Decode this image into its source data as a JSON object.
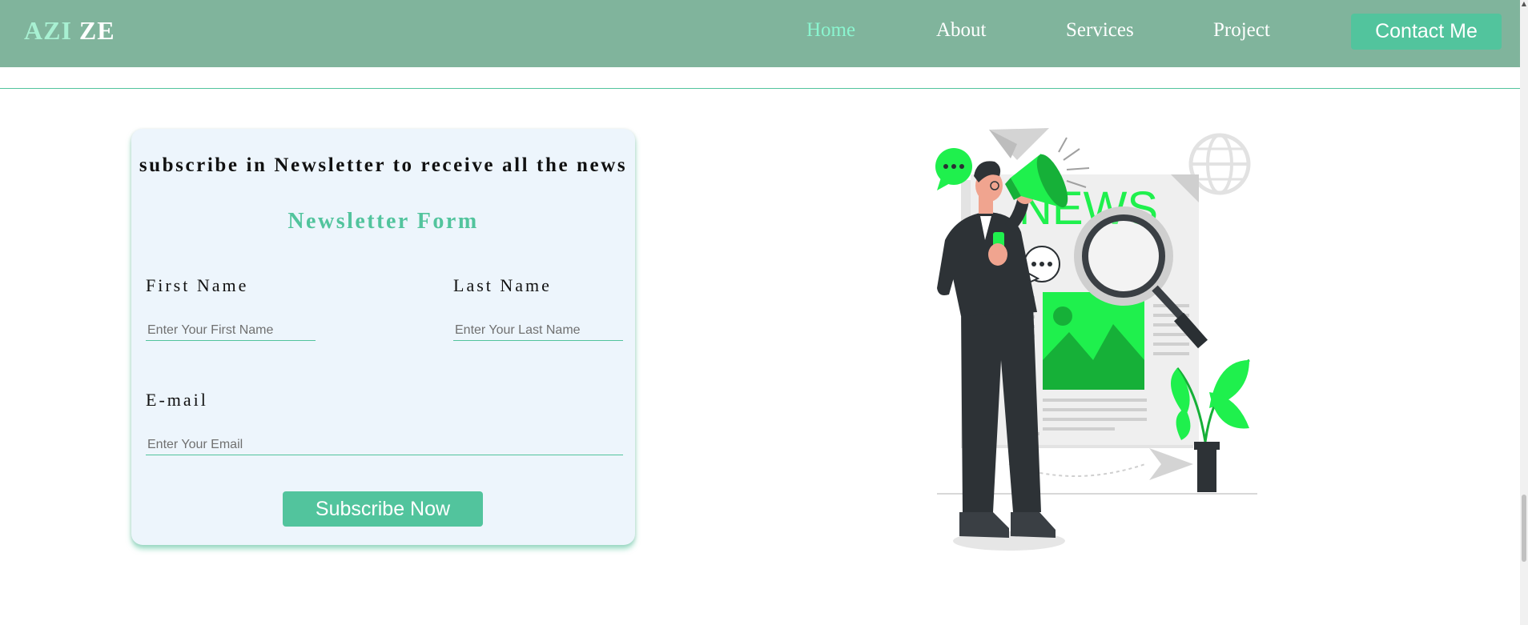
{
  "nav": {
    "logo_part1": "AZI",
    "logo_part2": "ZE",
    "links": [
      "Home",
      "About",
      "Services",
      "Project"
    ],
    "active_link": "Home",
    "contact_label": "Contact Me"
  },
  "newsletter": {
    "heading": "subscribe in Newsletter to receive all the news",
    "form_title": "Newsletter Form",
    "first_name_label": "First Name",
    "first_name_placeholder": "Enter Your First Name",
    "last_name_label": "Last Name",
    "last_name_placeholder": "Enter Your Last Name",
    "email_label": "E-mail",
    "email_placeholder": "Enter Your Email",
    "submit_label": "Subscribe Now"
  },
  "illustration": {
    "news_text": "NEWS",
    "icons": [
      "megaphone-icon",
      "newspaper-icon",
      "magnifier-icon",
      "globe-icon",
      "plant-icon",
      "paper-plane-icon",
      "chat-bubble-icon"
    ]
  },
  "colors": {
    "navbar": "#80b49c",
    "accent": "#52c49d",
    "active_link": "#8af5cf",
    "card_bg": "#edf5fc",
    "illustration_green": "#1ff04d"
  }
}
